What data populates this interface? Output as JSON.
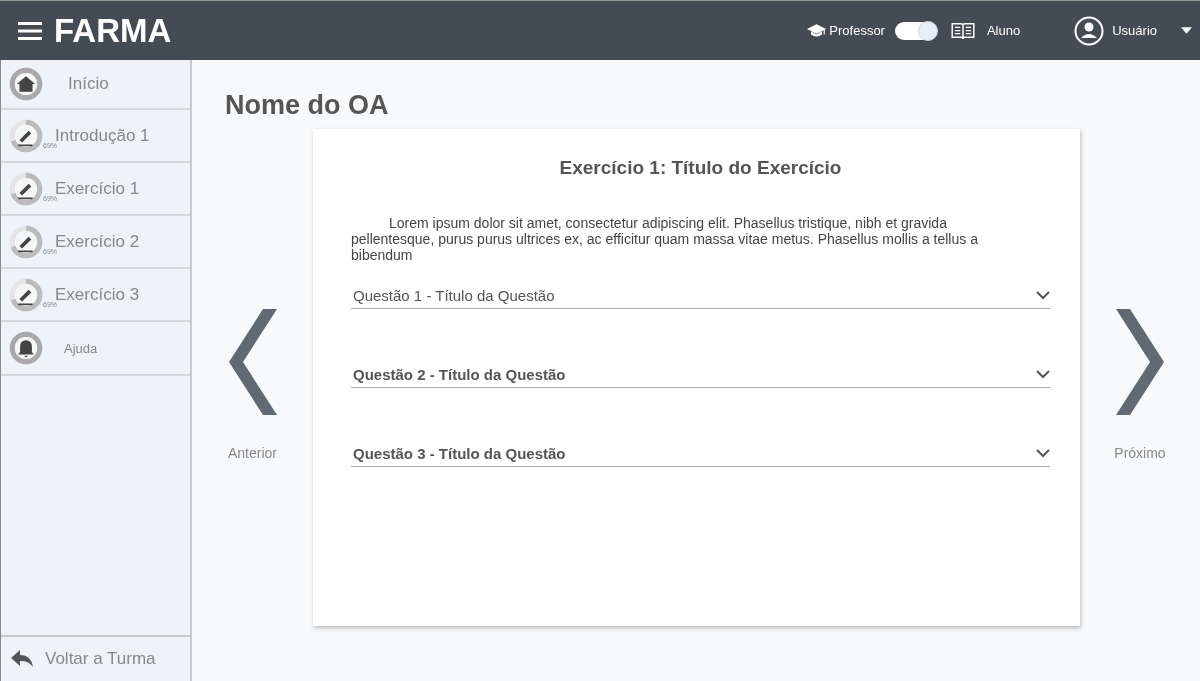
{
  "app": {
    "title": "FARMA"
  },
  "header": {
    "role_left": "Professor",
    "role_toggle_on": true,
    "role_right": "Aluno",
    "user": "Usuário"
  },
  "sidebar": {
    "items": [
      {
        "kind": "home",
        "label": "Início"
      },
      {
        "kind": "progress",
        "label": "Introdução 1",
        "level": 0.69,
        "percent": "69%"
      },
      {
        "kind": "progress",
        "label": "Exercício 1",
        "level": 0.69,
        "percent": "69%"
      },
      {
        "kind": "progress",
        "label": "Exercício 2",
        "level": 0.69,
        "percent": "69%"
      },
      {
        "kind": "progress",
        "label": "Exercício 3",
        "level": 0.69,
        "percent": "69%"
      },
      {
        "kind": "help",
        "label": "Ajuda"
      }
    ],
    "back": "Voltar a Turma"
  },
  "page": {
    "title": "Nome do OA",
    "prev": "Anterior",
    "next": "Próximo"
  },
  "exercise": {
    "title": "Exercício 1: Título do Exercício",
    "text": "Lorem ipsum dolor sit amet, consectetur adipiscing elit. Phasellus tristique,  nibh et gravida pellentesque, purus purus ultrices ex, ac efficitur quam  massa vitae metus. Phasellus mollis a tellus a bibendum",
    "questions": [
      {
        "label": "Questão 1 - Título da Questão",
        "bold": false,
        "expanded": false
      },
      {
        "label": "Questão 2 - Título da Questão",
        "bold": true,
        "expanded": false
      },
      {
        "label": "Questão 3 - Título da Questão",
        "bold": true,
        "expanded": false
      }
    ]
  }
}
